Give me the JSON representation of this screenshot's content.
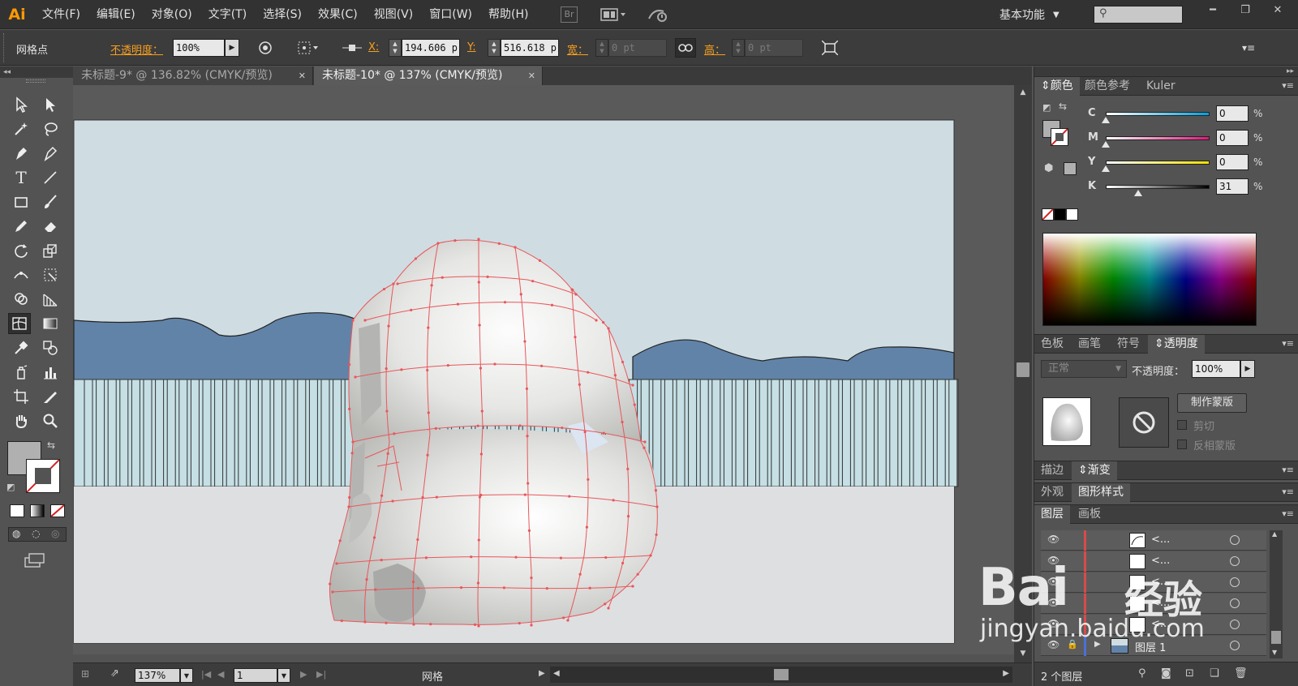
{
  "app": {
    "logo": "Ai"
  },
  "menu": [
    "文件(F)",
    "编辑(E)",
    "对象(O)",
    "文字(T)",
    "选择(S)",
    "效果(C)",
    "视图(V)",
    "窗口(W)",
    "帮助(H)"
  ],
  "bridge_label": "Br",
  "workspace": "基本功能",
  "control": {
    "selection_type": "网格点",
    "opacity_label": "不透明度：",
    "opacity_value": "100%",
    "x_label": "X:",
    "x_value": "194.606 p",
    "y_label": "Y:",
    "y_value": "516.618 p",
    "w_label": "宽：",
    "w_value": "0 pt",
    "h_label": "高：",
    "h_value": "0 pt"
  },
  "doc_tabs": [
    {
      "label": "未标题-9* @ 136.82% (CMYK/预览)",
      "active": false
    },
    {
      "label": "未标题-10* @ 137% (CMYK/预览)",
      "active": true
    }
  ],
  "status": {
    "zoom": "137%",
    "artboard": "1",
    "tool_name": "网格"
  },
  "panels": {
    "color_tabs": [
      "颜色",
      "颜色参考",
      "Kuler"
    ],
    "cmyk": [
      {
        "label": "C",
        "value": "0",
        "gradient": "linear-gradient(to right, #ffffff, #00a0e0)",
        "knob": 0
      },
      {
        "label": "M",
        "value": "0",
        "gradient": "linear-gradient(to right, #ffffff, #e0157a)",
        "knob": 0
      },
      {
        "label": "Y",
        "value": "0",
        "gradient": "linear-gradient(to right, #ffffff, #f0e000)",
        "knob": 0
      },
      {
        "label": "K",
        "value": "31",
        "gradient": "linear-gradient(to right, #ffffff, #000000)",
        "knob": 0.31
      }
    ],
    "percent": "%",
    "swatch_tabs": [
      "色板",
      "画笔",
      "符号",
      "透明度"
    ],
    "blend_mode": "正常",
    "transparency_opacity_label": "不透明度：",
    "transparency_opacity_value": "100%",
    "make_mask": "制作蒙版",
    "clip_label": "剪切",
    "invert_mask_label": "反相蒙版",
    "stroke_tabs": [
      "描边",
      "渐变"
    ],
    "appearance_tabs": [
      "外观",
      "图形样式"
    ],
    "layer_tabs": [
      "图层",
      "画板"
    ],
    "layers": [
      {
        "name": "<...",
        "bar": "red",
        "vector": true
      },
      {
        "name": "<...",
        "bar": "red",
        "vector": false
      },
      {
        "name": "<...",
        "bar": "red",
        "vector": false
      },
      {
        "name": "<...",
        "bar": "red",
        "vector": false
      },
      {
        "name": "<...",
        "bar": "red",
        "vector": false
      },
      {
        "name": "图层 1",
        "bar": "blue",
        "vector": false
      }
    ],
    "layer_count": "2 个图层"
  },
  "watermark": {
    "brand": "Bai",
    "brand2": "经验",
    "url": "jingyan.baidu.com"
  },
  "colors": {
    "sky": "#cfdde3",
    "mountain": "#6283a8",
    "fence": "#c5dfe4",
    "ground": "#dedfe1",
    "mesh": "#e8575a",
    "accent_orange": "#f7a01d"
  }
}
